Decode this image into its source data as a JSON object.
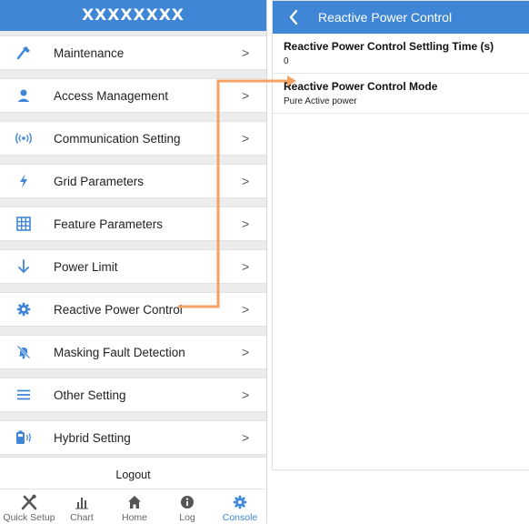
{
  "left_panel": {
    "title": "XXXXXXXX",
    "menu": [
      {
        "label": "Maintenance",
        "icon": "hammer-icon"
      },
      {
        "label": "Access Management",
        "icon": "user-icon"
      },
      {
        "label": "Communication Setting",
        "icon": "signal-icon"
      },
      {
        "label": "Grid Parameters",
        "icon": "lightning-icon"
      },
      {
        "label": "Feature Parameters",
        "icon": "grid-icon"
      },
      {
        "label": "Power Limit",
        "icon": "arrow-down-icon"
      },
      {
        "label": "Reactive Power Control",
        "icon": "gear-icon"
      },
      {
        "label": "Masking Fault Detection",
        "icon": "bell-off-icon"
      },
      {
        "label": "Other Setting",
        "icon": "menu-lines-icon"
      },
      {
        "label": "Hybrid Setting",
        "icon": "battery-icon"
      }
    ],
    "chevron": ">",
    "logout_label": "Logout"
  },
  "tabbar": [
    {
      "label": "Quick Setup",
      "icon": "tools-icon",
      "active": false
    },
    {
      "label": "Chart",
      "icon": "bar-chart-icon",
      "active": false
    },
    {
      "label": "Home",
      "icon": "home-icon",
      "active": false
    },
    {
      "label": "Log",
      "icon": "info-icon",
      "active": false
    },
    {
      "label": "Console",
      "icon": "gear-icon",
      "active": true
    }
  ],
  "right_panel": {
    "title": "Reactive Power Control",
    "settings": [
      {
        "title": "Reactive Power Control Settling Time (s)",
        "value": "0"
      },
      {
        "title": "Reactive Power Control Mode",
        "value": "Pure Active power"
      }
    ]
  },
  "colors": {
    "accent": "#3f86d6",
    "annotation": "#f4a261",
    "menu_background": "#ececec"
  }
}
